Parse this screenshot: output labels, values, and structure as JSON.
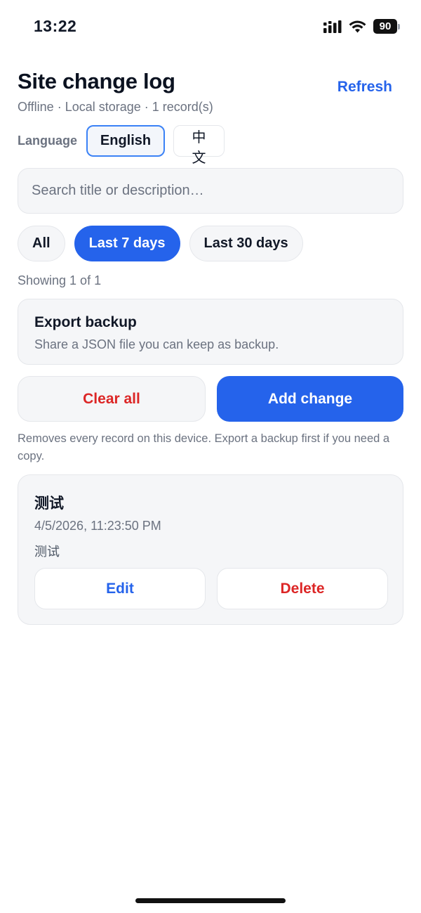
{
  "status_bar": {
    "time": "13:22",
    "battery": "90"
  },
  "header": {
    "title": "Site change log",
    "subtitle": "Offline · Local storage · 1 record(s)",
    "refresh_label": "Refresh"
  },
  "language": {
    "label": "Language",
    "options": [
      "English",
      "中文"
    ],
    "selected": "English"
  },
  "search": {
    "placeholder": "Search title or description…",
    "value": ""
  },
  "filters": {
    "options": [
      "All",
      "Last 7 days",
      "Last 30 days"
    ],
    "selected": "Last 7 days"
  },
  "showing": "Showing 1 of 1",
  "export": {
    "title": "Export backup",
    "description": "Share a JSON file you can keep as backup."
  },
  "actions": {
    "clear_label": "Clear all",
    "add_label": "Add change",
    "clear_hint": "Removes every record on this device. Export a backup first if you need a copy."
  },
  "records": [
    {
      "title": "测试",
      "date": "4/5/2026, 11:23:50 PM",
      "description": "测试",
      "edit_label": "Edit",
      "delete_label": "Delete"
    }
  ],
  "colors": {
    "accent": "#2563eb",
    "danger": "#dc2626",
    "muted_text": "#6b7280",
    "card_background": "#f5f6f8"
  }
}
